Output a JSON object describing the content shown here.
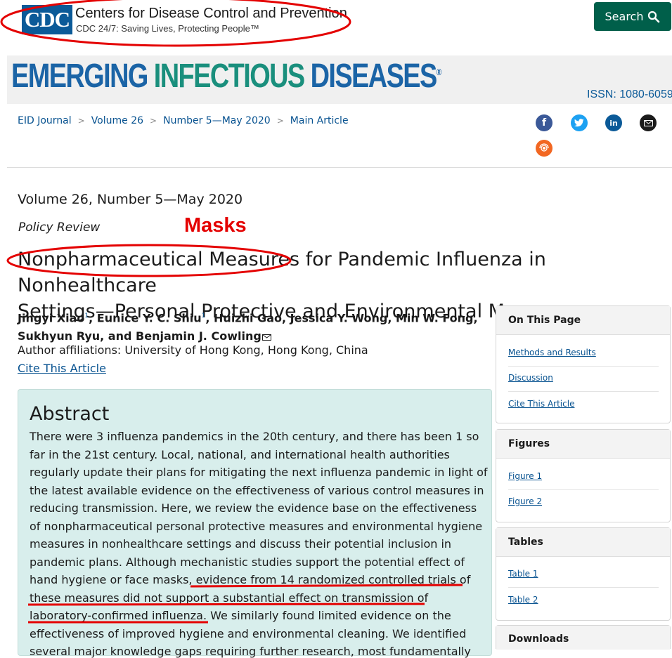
{
  "header": {
    "logo_text": "CDC",
    "org_name": "Centers for Disease Control and Prevention",
    "tagline": "CDC 24/7: Saving Lives, Protecting People™",
    "search_label": "Search",
    "search_icon": "search-icon"
  },
  "banner": {
    "title_part1": "EMERGING",
    "title_part2": "INFECTIOUS",
    "title_part3": "DISEASES",
    "registered": "®",
    "issn": "ISSN: 1080-6059"
  },
  "breadcrumb": [
    "EID Journal",
    "Volume 26",
    "Number 5—May 2020",
    "Main Article"
  ],
  "breadcrumb_sep": ">",
  "social": [
    "facebook-icon",
    "twitter-icon",
    "linkedin-icon",
    "email-icon",
    "syndicate-icon"
  ],
  "article": {
    "volume": "Volume 26, Number 5—May 2020",
    "type": "Policy Review",
    "title_line1": "Nonpharmaceutical Measures for Pandemic Influenza in Nonhealthcare",
    "title_line2": "Settings—Personal Protective and Environmental Measures",
    "authors": [
      {
        "name": "Jingyi Xiao",
        "sup": "1"
      },
      {
        "name": "Eunice Y. C. Shiu",
        "sup": "1"
      },
      {
        "name": "Huizhi Gao",
        "sup": ""
      },
      {
        "name": "Jessica Y. Wong",
        "sup": ""
      },
      {
        "name": "Min W. Fong",
        "sup": ""
      },
      {
        "name": "Sukhyun Ryu",
        "sup": ""
      },
      {
        "name": "Benjamin J. Cowling",
        "sup": ""
      }
    ],
    "affiliations": "Author affiliations: University of Hong Kong, Hong Kong, China",
    "cite_link": "Cite This Article"
  },
  "abstract": {
    "heading": "Abstract",
    "lines": [
      "There were 3 influenza pandemics in the 20th century, and there has been 1 so",
      "far in the 21st century. Local, national, and international health authorities",
      "regularly update their plans for mitigating the next influenza pandemic in light of",
      "the latest available evidence on the effectiveness of various control measures in",
      "reducing transmission. Here, we review the evidence base on the effectiveness",
      "of nonpharmaceutical personal protective measures and environmental hygiene",
      "measures in nonhealthcare settings and discuss their potential inclusion in",
      "pandemic plans. Although mechanistic studies support the potential effect of",
      "hand hygiene or face masks, evidence from 14 randomized controlled trials of",
      "these measures did not support a substantial effect on transmission of",
      "laboratory-confirmed influenza. We similarly found limited evidence on the",
      "effectiveness of improved hygiene and environmental cleaning. We identified",
      "several major knowledge gaps requiring further research, most fundamentally"
    ]
  },
  "annotation": {
    "label": "Masks",
    "color": "#e40000"
  },
  "sidebar": {
    "on_this_page": {
      "title": "On This Page",
      "items": [
        "Methods and Results",
        "Discussion",
        "Cite This Article"
      ]
    },
    "figures": {
      "title": "Figures",
      "items": [
        "Figure 1",
        "Figure 2"
      ]
    },
    "tables": {
      "title": "Tables",
      "items": [
        "Table 1",
        "Table 2"
      ]
    },
    "downloads": {
      "title": "Downloads"
    }
  }
}
